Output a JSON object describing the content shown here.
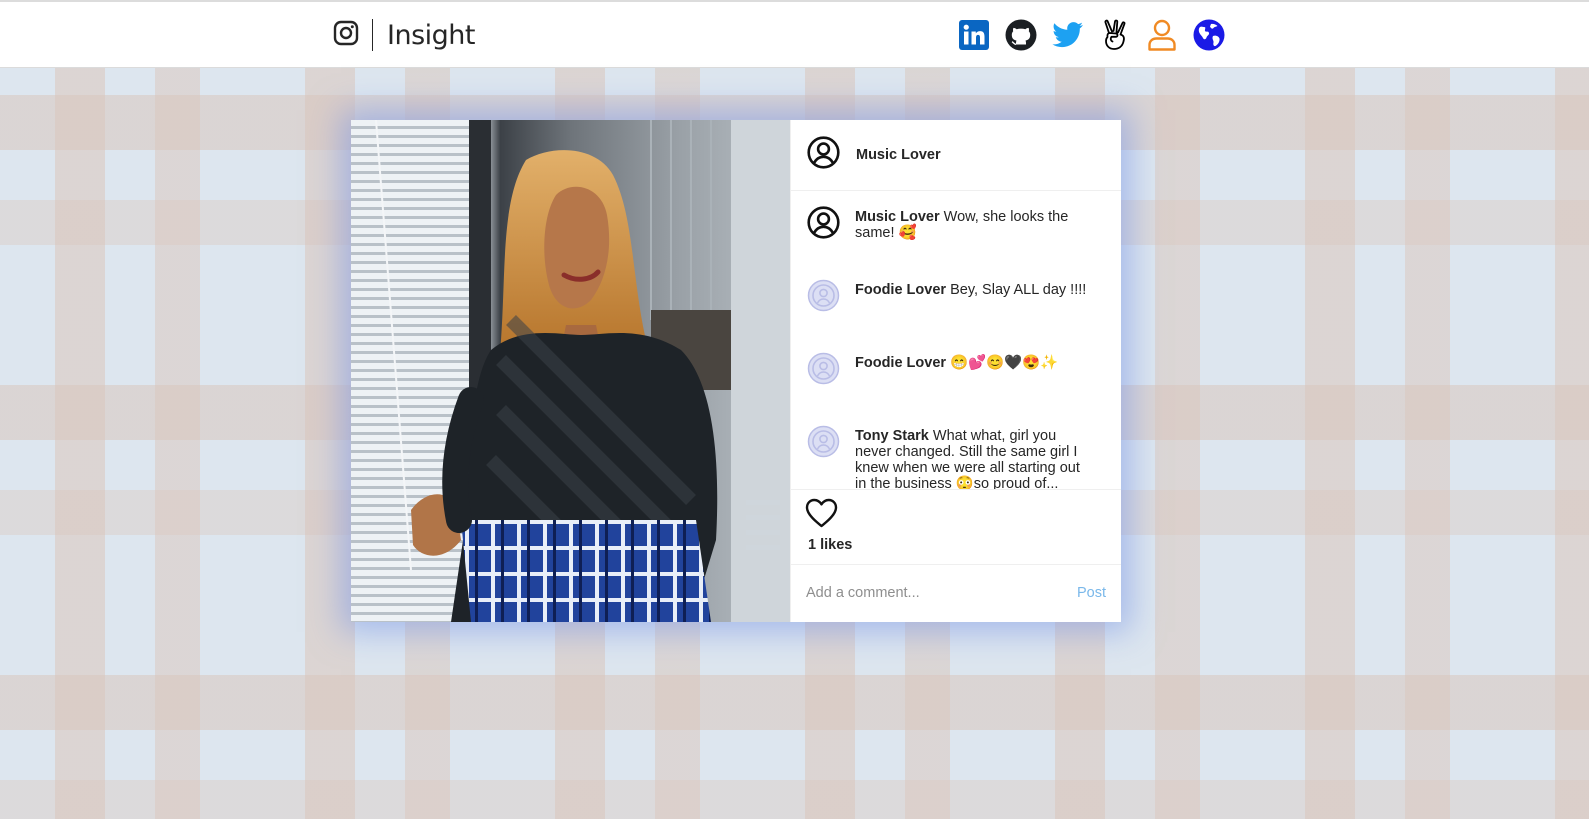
{
  "header": {
    "brand_icon": "instagram-icon",
    "brand_name": "Insight",
    "socials": [
      {
        "icon": "linkedin-icon",
        "color": "#0a66c2"
      },
      {
        "icon": "github-icon",
        "color": "#1b1f23"
      },
      {
        "icon": "twitter-icon",
        "color": "#1da1f2"
      },
      {
        "icon": "angellist-icon",
        "color": "#000000"
      },
      {
        "icon": "user-icon",
        "color": "#f08a24"
      },
      {
        "icon": "globe-icon",
        "color": "#1a1ae6"
      }
    ]
  },
  "post": {
    "author": "Music Lover",
    "image_alt": "photo",
    "comments": [
      {
        "user": "Music Lover",
        "text": "Wow, she looks the same! 🥰",
        "avatar": "user-circle-icon"
      },
      {
        "user": "Foodie Lover",
        "text": "Bey, Slay ALL day !!!!",
        "avatar": "default-avatar-icon"
      },
      {
        "user": "Foodie Lover",
        "text": "😁💕😊🖤😍✨",
        "avatar": "default-avatar-icon"
      },
      {
        "user": "Tony Stark",
        "text": "What what, girl you never changed. Still the same girl I knew when we were all starting out in the business 😳so proud of...",
        "avatar": "default-avatar-icon"
      }
    ],
    "likes_text": "1 likes",
    "comment_placeholder": "Add a comment...",
    "post_button": "Post"
  }
}
